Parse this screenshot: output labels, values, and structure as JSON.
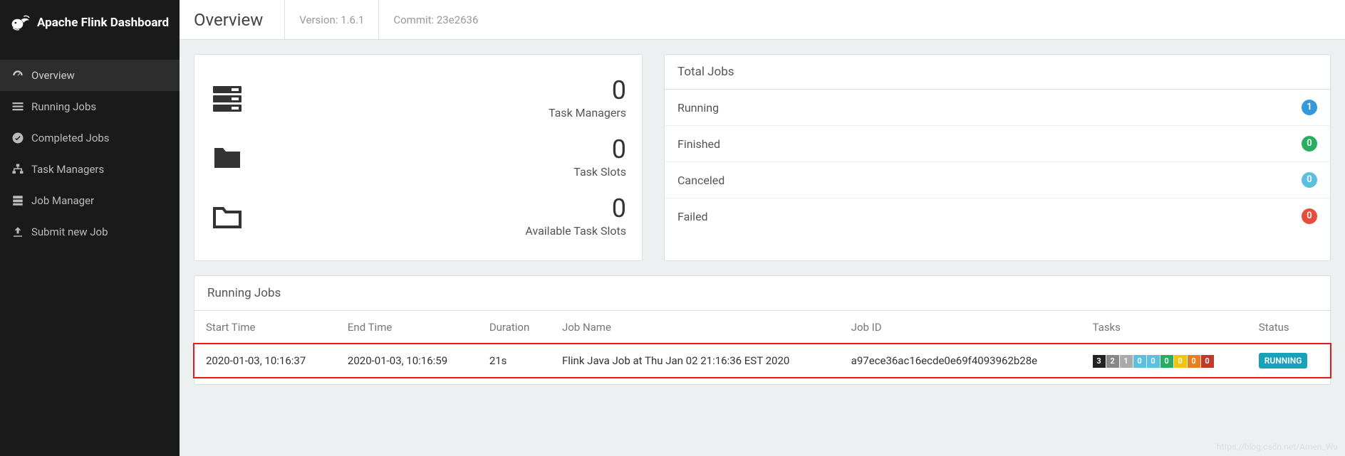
{
  "brand": {
    "title": "Apache Flink Dashboard"
  },
  "nav": {
    "items": [
      {
        "label": "Overview",
        "icon": "dashboard-icon",
        "active": true
      },
      {
        "label": "Running Jobs",
        "icon": "list-icon",
        "active": false
      },
      {
        "label": "Completed Jobs",
        "icon": "check-circle-icon",
        "active": false
      },
      {
        "label": "Task Managers",
        "icon": "sitemap-icon",
        "active": false
      },
      {
        "label": "Job Manager",
        "icon": "server-icon",
        "active": false
      },
      {
        "label": "Submit new Job",
        "icon": "upload-icon",
        "active": false
      }
    ]
  },
  "topbar": {
    "title": "Overview",
    "version_label": "Version: 1.6.1",
    "commit_label": "Commit: 23e2636"
  },
  "stats": [
    {
      "value": "0",
      "label": "Task Managers"
    },
    {
      "value": "0",
      "label": "Task Slots"
    },
    {
      "value": "0",
      "label": "Available Task Slots"
    }
  ],
  "total_jobs": {
    "title": "Total Jobs",
    "rows": [
      {
        "label": "Running",
        "count": "1",
        "color": "blue"
      },
      {
        "label": "Finished",
        "count": "0",
        "color": "green"
      },
      {
        "label": "Canceled",
        "count": "0",
        "color": "cyan"
      },
      {
        "label": "Failed",
        "count": "0",
        "color": "red"
      }
    ]
  },
  "running_jobs": {
    "title": "Running Jobs",
    "columns": [
      "Start Time",
      "End Time",
      "Duration",
      "Job Name",
      "Job ID",
      "Tasks",
      "Status"
    ],
    "rows": [
      {
        "start": "2020-01-03, 10:16:37",
        "end": "2020-01-03, 10:16:59",
        "duration": "21s",
        "name": "Flink Java Job at Thu Jan 02 21:16:36 EST 2020",
        "id": "a97ece36ac16ecde0e69f4093962b28e",
        "tasks": [
          "3",
          "2",
          "1",
          "0",
          "0",
          "0",
          "0",
          "0",
          "0"
        ],
        "status": "RUNNING"
      }
    ]
  },
  "watermark": "https://blog.csdn.net/Amen_Wu"
}
